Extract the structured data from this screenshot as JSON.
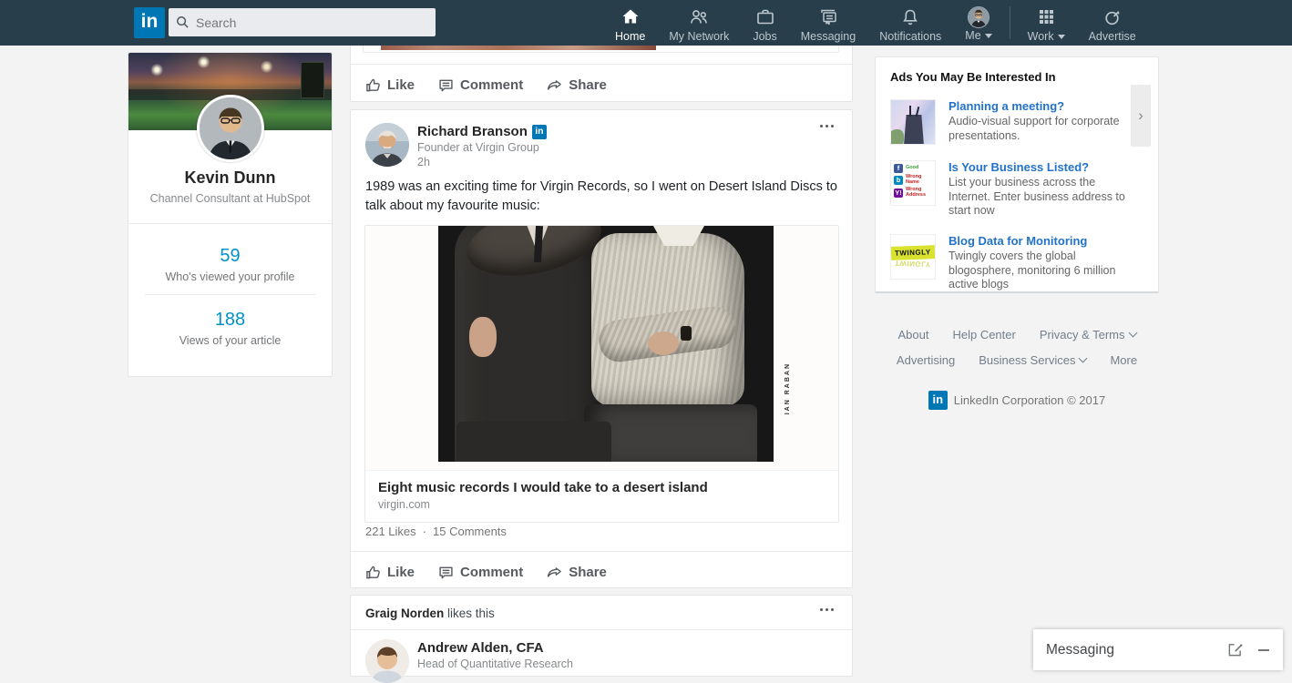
{
  "colors": {
    "brand_blue": "#0077b5",
    "nav_bg": "#283e4a",
    "stat_link_blue": "#0091ca",
    "ad_link_blue": "#2272c8"
  },
  "nav": {
    "logo": "in",
    "search_placeholder": "Search",
    "items": [
      {
        "label": "Home"
      },
      {
        "label": "My Network"
      },
      {
        "label": "Jobs"
      },
      {
        "label": "Messaging"
      },
      {
        "label": "Notifications"
      },
      {
        "label": "Me"
      }
    ],
    "work_label": "Work",
    "advertise_label": "Advertise"
  },
  "profile_card": {
    "name": "Kevin Dunn",
    "headline": "Channel Consultant at HubSpot",
    "stats": [
      {
        "value": "59",
        "label": "Who's viewed your profile"
      },
      {
        "value": "188",
        "label": "Views of your article"
      }
    ]
  },
  "actions": {
    "like": "Like",
    "comment": "Comment",
    "share": "Share"
  },
  "feed": {
    "branson_post": {
      "author": "Richard Branson",
      "badge": "in",
      "author_headline": "Founder at Virgin Group",
      "time": "2h",
      "text": "1989 was an exciting time for Virgin Records, so I went on Desert Island Discs to talk about my favourite music:",
      "photo_credit": "IAN RABAN",
      "link_title": "Eight music records I would take to a desert island",
      "link_domain": "virgin.com",
      "likes": "221 Likes",
      "separator": "·",
      "comments": "15 Comments"
    },
    "liked_post": {
      "actor": "Graig Norden",
      "action": "likes this",
      "author": "Andrew Alden, CFA",
      "author_headline": "Head of Quantitative Research"
    }
  },
  "ads": {
    "title": "Ads You May Be Interested In",
    "items": [
      {
        "headline": "Planning a meeting?",
        "description": "Audio-visual support for corporate presentations."
      },
      {
        "headline": "Is Your Business Listed?",
        "description": "List your business across the Internet. Enter business address to start now"
      },
      {
        "headline": "Blog Data for Monitoring",
        "description": "Twingly covers the global blogosphere, monitoring 6 million active blogs"
      }
    ],
    "listing_badges": [
      {
        "icon": "f",
        "label": "Good"
      },
      {
        "icon": "b",
        "label": "Wrong Name"
      },
      {
        "icon": "Y!",
        "label": "Wrong Address"
      }
    ],
    "twingly_logo_text": "TWINGLY",
    "next_arrow": "›"
  },
  "footer": {
    "links": [
      {
        "label": "About"
      },
      {
        "label": "Help Center"
      },
      {
        "label": "Privacy & Terms"
      },
      {
        "label": "Advertising"
      },
      {
        "label": "Business Services"
      },
      {
        "label": "More"
      }
    ],
    "logo": "in",
    "copyright": "LinkedIn Corporation © 2017"
  },
  "messaging_panel": {
    "title": "Messaging"
  }
}
